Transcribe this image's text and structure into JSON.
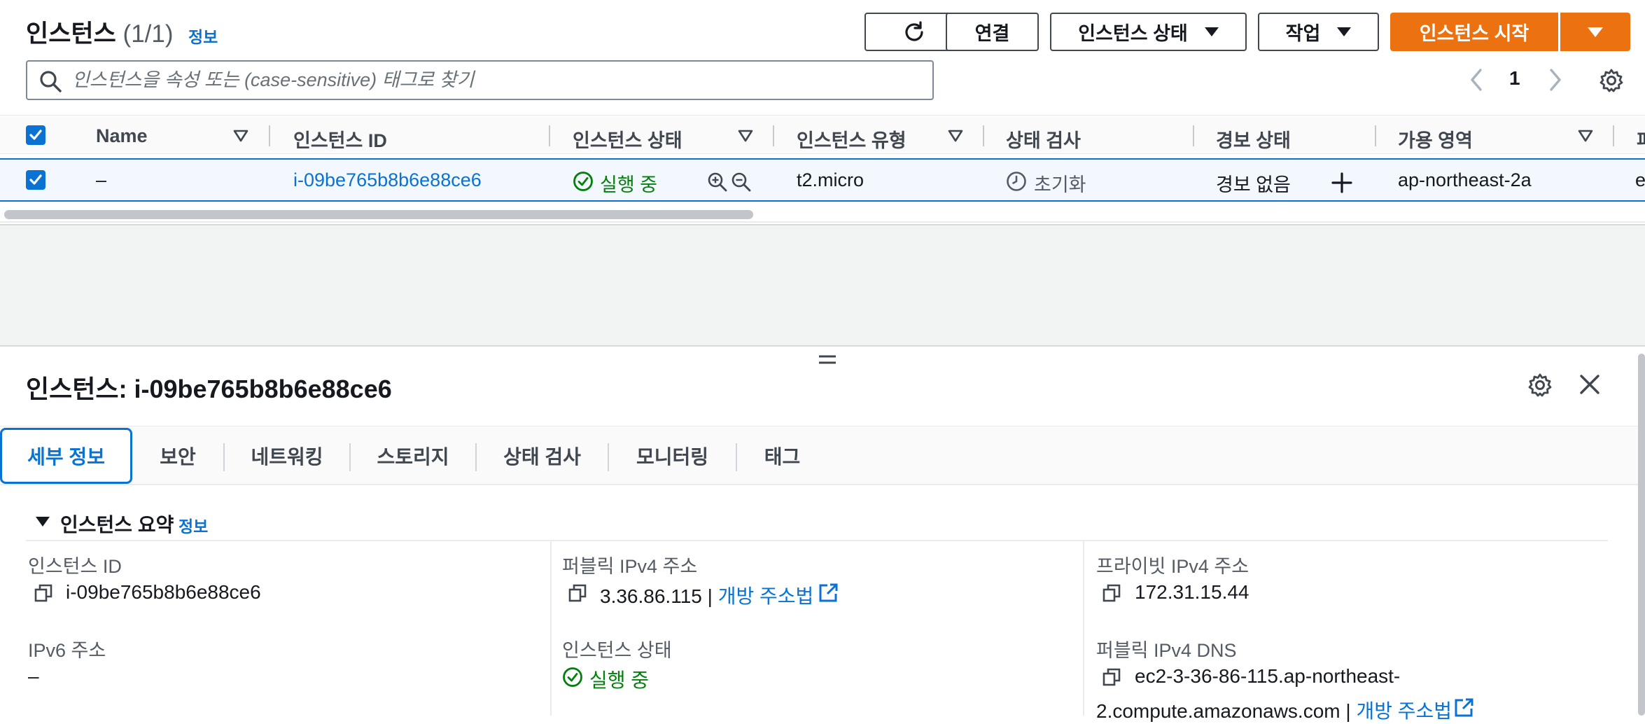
{
  "header": {
    "title": "인스턴스",
    "count": "(1/1)",
    "info": "정보",
    "buttons": {
      "connect": "연결",
      "instance_state": "인스턴스 상태",
      "actions": "작업",
      "launch": "인스턴스 시작"
    },
    "search_placeholder": "인스턴스을 속성 또는 (case-sensitive) 태그로 찾기",
    "page": "1"
  },
  "table": {
    "columns": [
      "Name",
      "인스턴스 ID",
      "인스턴스 상태",
      "인스턴스 유형",
      "상태 검사",
      "경보 상태",
      "가용 영역",
      "퍼"
    ],
    "row": {
      "name": "–",
      "instance_id": "i-09be765b8b6e88ce6",
      "state": "실행 중",
      "type": "t2.micro",
      "status_check": "초기화",
      "alarm": "경보 없음",
      "az": "ap-northeast-2a",
      "overflow": "e"
    }
  },
  "detail": {
    "title": "인스턴스: i-09be765b8b6e88ce6",
    "tabs": [
      "세부 정보",
      "보안",
      "네트워킹",
      "스토리지",
      "상태 검사",
      "모니터링",
      "태그"
    ],
    "summary_title": "인스턴스 요약",
    "summary_info": "정보",
    "fields": {
      "instance_id_label": "인스턴스 ID",
      "instance_id_value": "i-09be765b8b6e88ce6",
      "public_ipv4_label": "퍼블릭 IPv4 주소",
      "public_ipv4_value": "3.36.86.115",
      "public_ipv4_sep": "|",
      "open_address": "개방 주소법",
      "private_ipv4_label": "프라이빗 IPv4 주소",
      "private_ipv4_value": "172.31.15.44",
      "ipv6_label": "IPv6 주소",
      "ipv6_value": "–",
      "state_label": "인스턴스 상태",
      "state_value": "실행 중",
      "public_dns_label": "퍼블릭 IPv4 DNS",
      "public_dns_line1": "ec2-3-36-86-115.ap-northeast-",
      "public_dns_line2": "2.compute.amazonaws.com",
      "public_dns_sep": "|",
      "public_dns_link": "개방 주소법"
    }
  },
  "colors": {
    "primary": "#ec7211",
    "link": "#0972d3",
    "success": "#037f0c"
  }
}
